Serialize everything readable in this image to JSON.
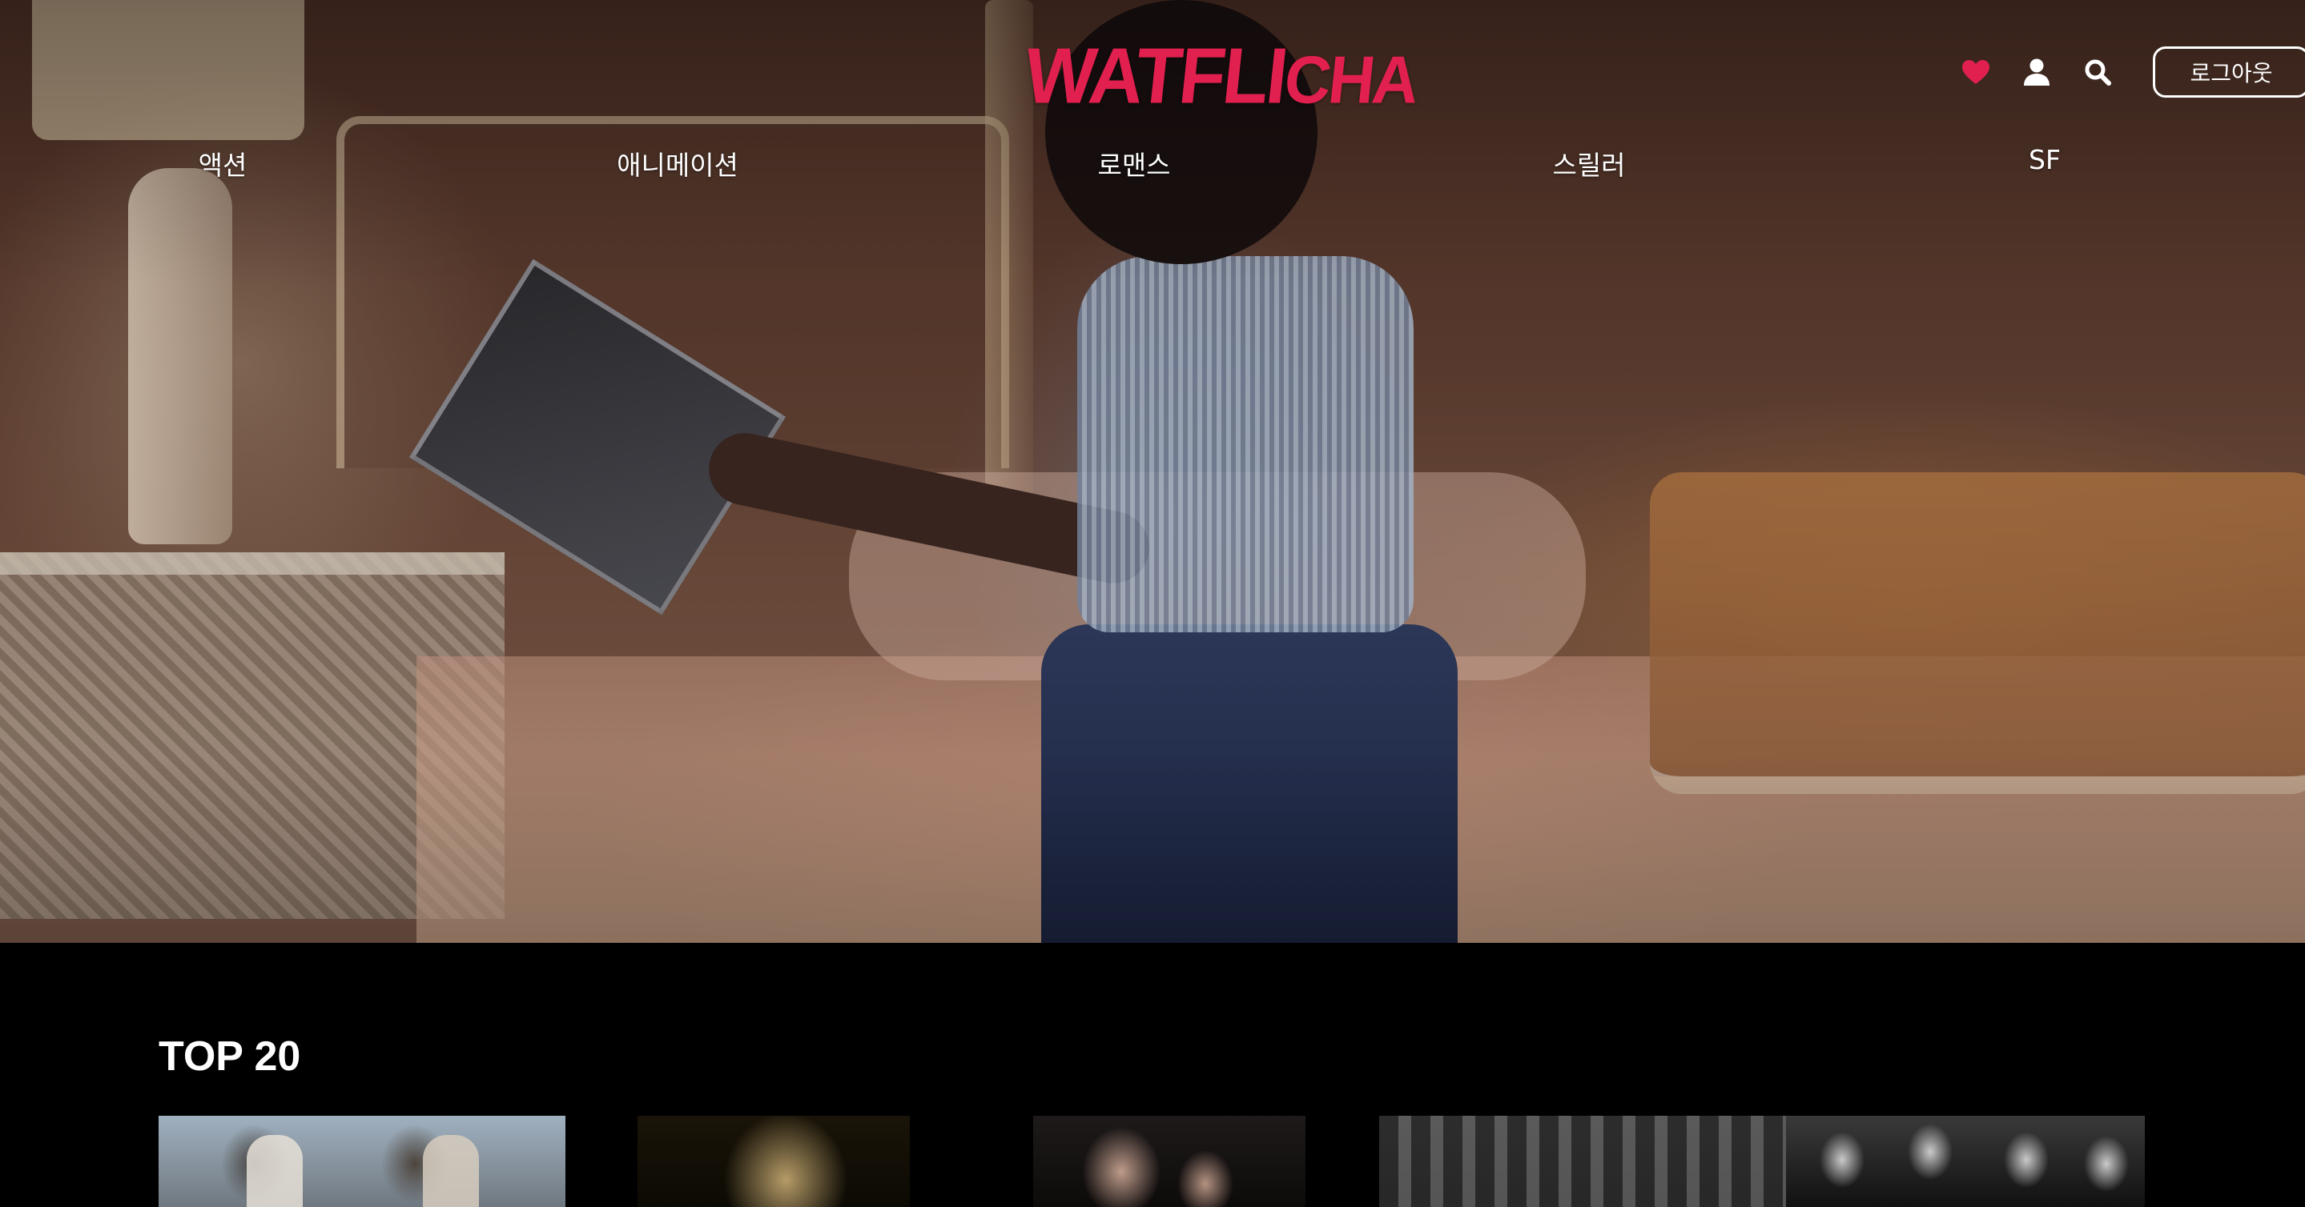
{
  "header": {
    "logo_main": "WATFLI",
    "logo_tail": "CHA",
    "logout_label": "로그아웃",
    "icons": [
      "heart-icon",
      "user-icon",
      "search-icon"
    ],
    "heart_color": "#e2204f"
  },
  "nav": {
    "genres": [
      "액션",
      "애니메이션",
      "로맨스",
      "스릴러",
      "SF"
    ]
  },
  "top20": {
    "title": "TOP 20",
    "posters": [
      {
        "id": "poster-1"
      },
      {
        "id": "poster-2"
      },
      {
        "id": "poster-3"
      },
      {
        "id": "poster-4"
      },
      {
        "id": "poster-5"
      }
    ]
  },
  "colors": {
    "brand": "#e2204f",
    "background": "#000000",
    "text": "#ffffff"
  }
}
